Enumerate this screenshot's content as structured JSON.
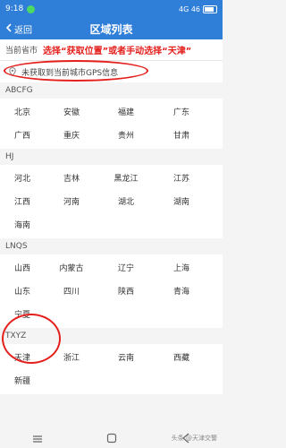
{
  "status_bar": {
    "time": "9:18",
    "right_text": "4G 46",
    "battery_level": 0.8
  },
  "nav": {
    "back_label": "返回",
    "title": "区域列表"
  },
  "current_province": {
    "label": "当前省市",
    "annotation": "选择“获取位置”或者手动选择“天津”"
  },
  "gps": {
    "text": "未获取到当前城市GPS信息"
  },
  "groups": [
    {
      "header": "ABCFG",
      "cities": [
        "北京",
        "安徽",
        "福建",
        "广东",
        "广西",
        "重庆",
        "贵州",
        "甘肃"
      ]
    },
    {
      "header": "HJ",
      "cities": [
        "河北",
        "吉林",
        "黑龙江",
        "江苏",
        "江西",
        "河南",
        "湖北",
        "湖南",
        "海南"
      ]
    },
    {
      "header": "LNQS",
      "cities": [
        "山西",
        "内蒙古",
        "辽宁",
        "上海",
        "山东",
        "四川",
        "陕西",
        "青海",
        "宁夏"
      ]
    },
    {
      "header": "TXYZ",
      "cities": [
        "天津",
        "浙江",
        "云南",
        "西藏",
        "新疆"
      ]
    }
  ],
  "watermark": "头条 @天津交警",
  "icons": {
    "back": "chevron-left-icon",
    "gps": "location-pin-icon",
    "menu": "menu-icon",
    "home": "home-square-icon",
    "back_nav": "back-triangle-icon"
  },
  "colors": {
    "header_blue": "#2f7ed8",
    "annotation_red": "#e4201d"
  }
}
